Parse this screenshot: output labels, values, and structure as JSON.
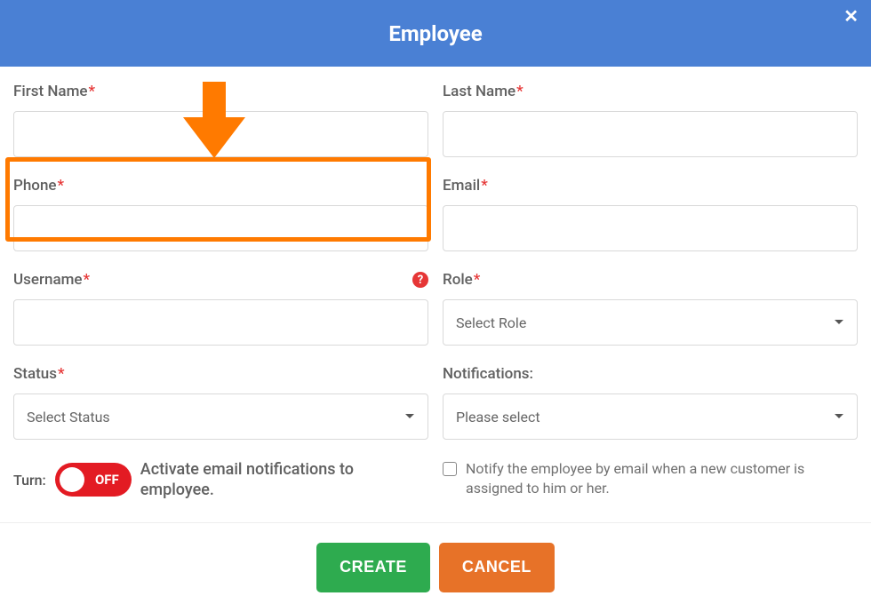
{
  "header": {
    "title": "Employee"
  },
  "fields": {
    "first_name": {
      "label": "First Name",
      "required": "*"
    },
    "last_name": {
      "label": "Last Name",
      "required": "*"
    },
    "phone": {
      "label": "Phone",
      "required": "*"
    },
    "email": {
      "label": "Email",
      "required": "*"
    },
    "username": {
      "label": "Username",
      "required": "*"
    },
    "role": {
      "label": "Role",
      "required": "*",
      "selected": "Select Role"
    },
    "status": {
      "label": "Status",
      "required": "*",
      "selected": "Select Status"
    },
    "notifications": {
      "label": "Notifications:",
      "selected": "Please select"
    }
  },
  "toggle": {
    "turn_label": "Turn:",
    "state": "OFF",
    "desc": "Activate email notifications to employee."
  },
  "notify_checkbox": {
    "text": "Notify the employee by email when a new customer is assigned to him or her."
  },
  "buttons": {
    "create": "CREATE",
    "cancel": "CANCEL"
  },
  "icons": {
    "help": "?"
  },
  "colors": {
    "header": "#4a80d4",
    "required": "#e63636",
    "toggle": "#e31b23",
    "create": "#2eab4f",
    "cancel": "#e77228",
    "highlight": "#ff7a00"
  }
}
